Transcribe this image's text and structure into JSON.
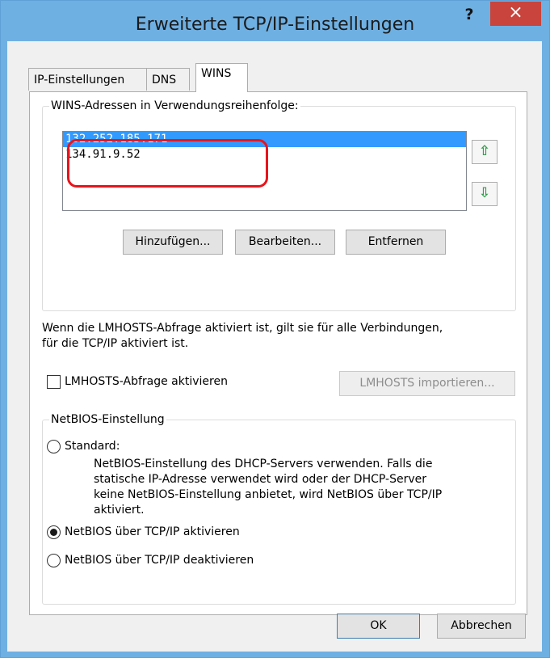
{
  "window": {
    "title": "Erweiterte TCP/IP-Einstellungen",
    "help_label": "?",
    "close_label": "×"
  },
  "tabs": [
    {
      "label": "IP-Einstellungen",
      "active": false
    },
    {
      "label": "DNS",
      "active": false
    },
    {
      "label": "WINS",
      "active": true
    }
  ],
  "wins": {
    "group_label": "WINS-Adressen in Verwendungsreihenfolge:",
    "addresses": [
      "132.252.185.171",
      "134.91.9.52"
    ],
    "selected_index": 0,
    "move_up_icon": "⇧",
    "move_down_icon": "⇩",
    "add_label": "Hinzufügen...",
    "edit_label": "Bearbeiten...",
    "remove_label": "Entfernen"
  },
  "lmhosts": {
    "info_line1": "Wenn die LMHOSTS-Abfrage aktiviert ist, gilt sie für alle Verbindungen,",
    "info_line2": "für die TCP/IP aktiviert ist.",
    "checkbox_label": "LMHOSTS-Abfrage aktivieren",
    "checked": false,
    "import_label": "LMHOSTS importieren..."
  },
  "netbios": {
    "group_label": "NetBIOS-Einstellung",
    "standard_label": "Standard:",
    "standard_desc": [
      "NetBIOS-Einstellung des DHCP-Servers verwenden. Falls die",
      "statische IP-Adresse verwendet wird oder der DHCP-Server",
      "keine NetBIOS-Einstellung anbietet, wird NetBIOS über TCP/IP",
      "aktiviert."
    ],
    "enable_label": "NetBIOS über TCP/IP aktivieren",
    "disable_label": "NetBIOS über TCP/IP deaktivieren",
    "selected": "enable"
  },
  "footer": {
    "ok_label": "OK",
    "cancel_label": "Abbrechen"
  },
  "colors": {
    "titlebar": "#6fb0e3",
    "close": "#c8443c",
    "selection": "#3399ff",
    "annotation": "#e8141b",
    "arrow": "#2fa14a"
  }
}
